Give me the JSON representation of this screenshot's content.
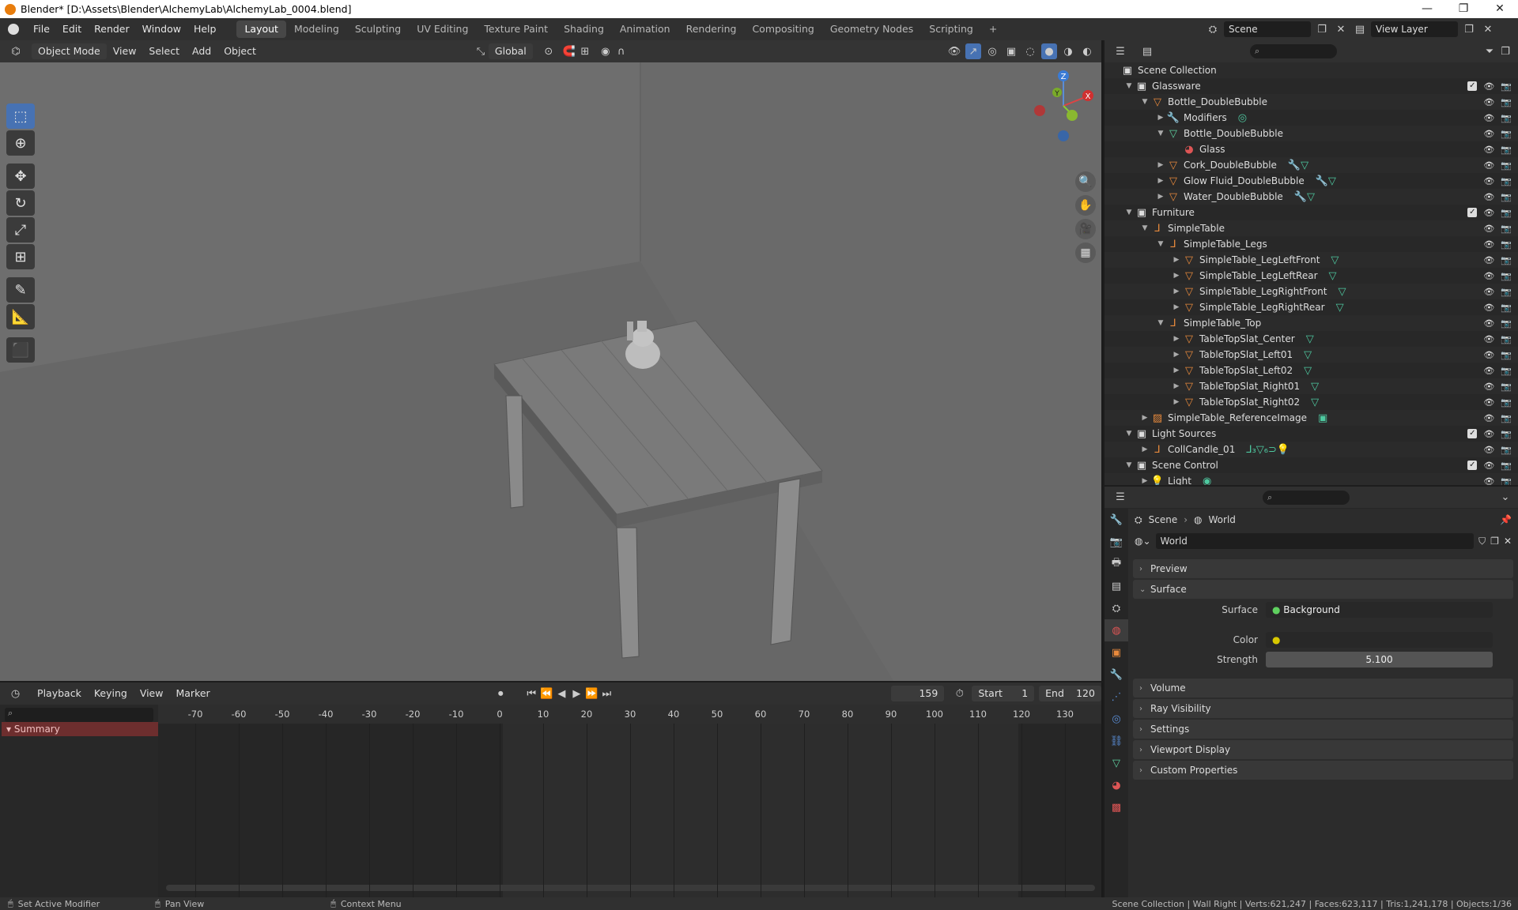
{
  "window": {
    "title": "Blender* [D:\\Assets\\Blender\\AlchemyLab\\AlchemyLab_0004.blend]",
    "controls": [
      "—",
      "❐",
      "✕"
    ]
  },
  "menubar": {
    "menus": [
      "File",
      "Edit",
      "Render",
      "Window",
      "Help"
    ],
    "workspaces": [
      "Layout",
      "Modeling",
      "Sculpting",
      "UV Editing",
      "Texture Paint",
      "Shading",
      "Animation",
      "Rendering",
      "Compositing",
      "Geometry Nodes",
      "Scripting"
    ],
    "active_workspace": "Layout",
    "add_tab": "+",
    "scene": "Scene",
    "view_layer": "View Layer"
  },
  "viewport": {
    "mode": "Object Mode",
    "menus": [
      "View",
      "Select",
      "Add",
      "Object"
    ],
    "orientation": "Global",
    "gizmo_axes": {
      "x": "X",
      "y": "Y",
      "z": "Z"
    },
    "colors": {
      "x": "#d44",
      "y": "#8c3",
      "z": "#48c"
    }
  },
  "outliner": {
    "root": "Scene Collection",
    "rows": [
      {
        "depth": 1,
        "twisty": "▼",
        "icon": "collection",
        "label": "Glassware",
        "check": true
      },
      {
        "depth": 2,
        "twisty": "▼",
        "icon": "mesh",
        "label": "Bottle_DoubleBubble"
      },
      {
        "depth": 3,
        "twisty": "▶",
        "icon": "wrench",
        "label": "Modifiers",
        "extra": "◎"
      },
      {
        "depth": 3,
        "twisty": "▼",
        "icon": "mesh-data",
        "label": "Bottle_DoubleBubble"
      },
      {
        "depth": 4,
        "twisty": "",
        "icon": "material",
        "label": "Glass"
      },
      {
        "depth": 3,
        "twisty": "▶",
        "icon": "mesh",
        "label": "Cork_DoubleBubble",
        "extra": "🔧▽"
      },
      {
        "depth": 3,
        "twisty": "▶",
        "icon": "mesh",
        "label": "Glow Fluid_DoubleBubble",
        "extra": "🔧▽"
      },
      {
        "depth": 3,
        "twisty": "▶",
        "icon": "mesh",
        "label": "Water_DoubleBubble",
        "extra": "🔧▽"
      },
      {
        "depth": 1,
        "twisty": "▼",
        "icon": "collection",
        "label": "Furniture",
        "check": true
      },
      {
        "depth": 2,
        "twisty": "▼",
        "icon": "empty",
        "label": "SimpleTable"
      },
      {
        "depth": 3,
        "twisty": "▼",
        "icon": "empty",
        "label": "SimpleTable_Legs"
      },
      {
        "depth": 4,
        "twisty": "▶",
        "icon": "mesh",
        "label": "SimpleTable_LegLeftFront",
        "extra": "▽"
      },
      {
        "depth": 4,
        "twisty": "▶",
        "icon": "mesh",
        "label": "SimpleTable_LegLeftRear",
        "extra": "▽"
      },
      {
        "depth": 4,
        "twisty": "▶",
        "icon": "mesh",
        "label": "SimpleTable_LegRightFront",
        "extra": "▽"
      },
      {
        "depth": 4,
        "twisty": "▶",
        "icon": "mesh",
        "label": "SimpleTable_LegRightRear",
        "extra": "▽"
      },
      {
        "depth": 3,
        "twisty": "▼",
        "icon": "empty",
        "label": "SimpleTable_Top"
      },
      {
        "depth": 4,
        "twisty": "▶",
        "icon": "mesh",
        "label": "TableTopSlat_Center",
        "extra": "▽"
      },
      {
        "depth": 4,
        "twisty": "▶",
        "icon": "mesh",
        "label": "TableTopSlat_Left01",
        "extra": "▽"
      },
      {
        "depth": 4,
        "twisty": "▶",
        "icon": "mesh",
        "label": "TableTopSlat_Left02",
        "extra": "▽"
      },
      {
        "depth": 4,
        "twisty": "▶",
        "icon": "mesh",
        "label": "TableTopSlat_Right01",
        "extra": "▽"
      },
      {
        "depth": 4,
        "twisty": "▶",
        "icon": "mesh",
        "label": "TableTopSlat_Right02",
        "extra": "▽"
      },
      {
        "depth": 2,
        "twisty": "▶",
        "icon": "image",
        "label": "SimpleTable_ReferenceImage",
        "extra": "▣"
      },
      {
        "depth": 1,
        "twisty": "▼",
        "icon": "collection",
        "label": "Light Sources",
        "check": true
      },
      {
        "depth": 2,
        "twisty": "▶",
        "icon": "empty",
        "label": "CollCandle_01",
        "extra": "⅃₃▽₆⊃💡"
      },
      {
        "depth": 1,
        "twisty": "▼",
        "icon": "collection",
        "label": "Scene Control",
        "check": true
      },
      {
        "depth": 2,
        "twisty": "▶",
        "icon": "light",
        "label": "Light",
        "extra": "◉"
      }
    ]
  },
  "properties": {
    "breadcrumb": [
      "Scene",
      "World"
    ],
    "datablock": "World",
    "panels": {
      "preview": "Preview",
      "surface": "Surface",
      "volume": "Volume",
      "ray_visibility": "Ray Visibility",
      "settings": "Settings",
      "viewport_display": "Viewport Display",
      "custom_properties": "Custom Properties"
    },
    "surface": {
      "surface_label": "Surface",
      "surface_value": "Background",
      "color_label": "Color",
      "strength_label": "Strength",
      "strength_value": "5.100"
    }
  },
  "timeline": {
    "menus": [
      "Playback",
      "Keying",
      "View",
      "Marker"
    ],
    "current_frame": "159",
    "start_label": "Start",
    "start": "1",
    "end_label": "End",
    "end": "120",
    "ticks": [
      "-70",
      "-60",
      "-50",
      "-40",
      "-30",
      "-20",
      "-10",
      "0",
      "10",
      "20",
      "30",
      "40",
      "50",
      "60",
      "70",
      "80",
      "90",
      "100",
      "110",
      "120",
      "130"
    ],
    "summary": "Summary"
  },
  "statusbar": {
    "left1": "Set Active Modifier",
    "left2": "Pan View",
    "left3": "Context Menu",
    "right": "Scene Collection | Wall Right | Verts:621,247 | Faces:623,117 | Tris:1,241,178 | Objects:1/36"
  }
}
